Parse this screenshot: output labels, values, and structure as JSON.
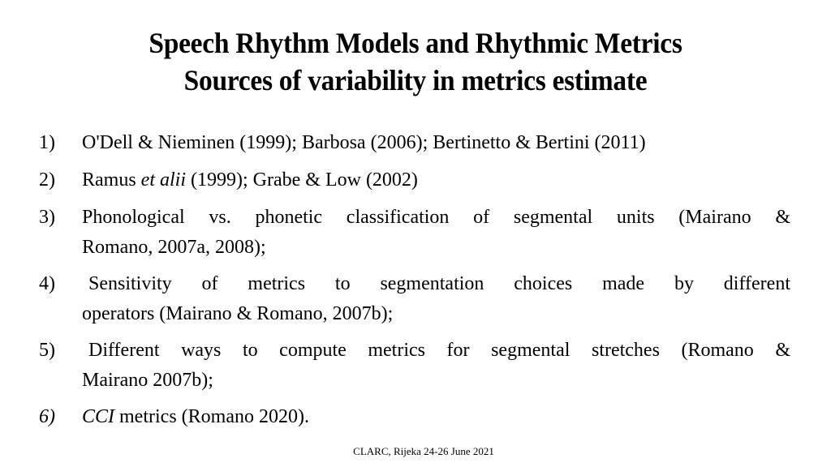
{
  "slide": {
    "title_line1": "Speech Rhythm Models and Rhythmic Metrics",
    "title_line2": "Sources of variability in metrics estimate",
    "items": [
      {
        "number": "1)",
        "lines": [
          "O'Dell & Nieminen (1999); Barbosa (2006); Bertinetto & Bertini (2011)"
        ]
      },
      {
        "number": "2)",
        "prefix": "Ramus ",
        "italic": "et alii",
        "suffix": " (1999); Grabe & Low (2002)"
      },
      {
        "number": "3)",
        "lines": [
          "Phonological vs. phonetic classification of segmental units (Mairano &",
          "Romano, 2007a, 2008);"
        ]
      },
      {
        "number": "4)",
        "lines": [
          " Sensitivity of metrics to segmentation choices made by different",
          "operators (Mairano & Romano, 2007b);"
        ]
      },
      {
        "number": "5)",
        "lines": [
          " Different ways to compute metrics for segmental stretches (Romano &",
          "Mairano 2007b);"
        ]
      },
      {
        "number": "6)",
        "italic": "CCI",
        "suffix": " metrics (Romano 2020)."
      }
    ],
    "footer": "CLARC, Rijeka 24-26 June 2021"
  }
}
